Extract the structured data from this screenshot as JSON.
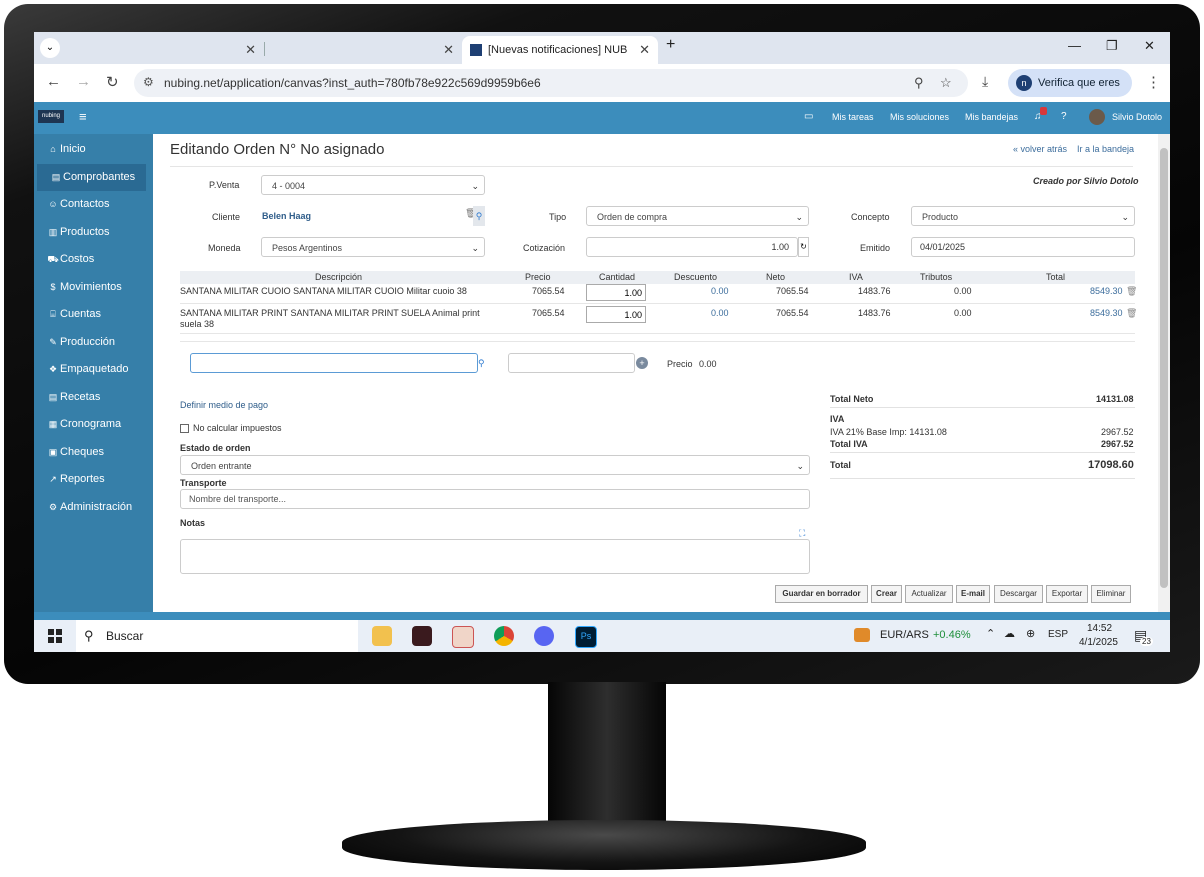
{
  "browser": {
    "tabs": [
      {
        "title": "",
        "active": false
      },
      {
        "title": "",
        "active": false
      },
      {
        "title": "[Nuevas notificaciones] NUBING",
        "active": true
      }
    ],
    "url": "nubing.net/application/canvas?inst_auth=780fb78e922c569d9959b6e6",
    "verify_label": "Verifica que eres tú"
  },
  "header": {
    "logo": "nubing",
    "links": [
      "Mis tareas",
      "Mis soluciones",
      "Mis bandejas"
    ],
    "user": "Silvio Dotolo"
  },
  "sidebar": {
    "items": [
      {
        "label": "Inicio",
        "icon": "home-icon",
        "glyph": "⌂"
      },
      {
        "label": "Comprobantes",
        "icon": "list-icon",
        "glyph": "▤"
      },
      {
        "label": "Contactos",
        "icon": "users-icon",
        "glyph": "☺"
      },
      {
        "label": "Productos",
        "icon": "box-icon",
        "glyph": "▥"
      },
      {
        "label": "Costos",
        "icon": "cart-icon",
        "glyph": "⛟"
      },
      {
        "label": "Movimientos",
        "icon": "dollar-icon",
        "glyph": "$"
      },
      {
        "label": "Cuentas",
        "icon": "bank-icon",
        "glyph": "⌸"
      },
      {
        "label": "Producción",
        "icon": "wrench-icon",
        "glyph": "✎"
      },
      {
        "label": "Empaquetado",
        "icon": "cubes-icon",
        "glyph": "❖"
      },
      {
        "label": "Recetas",
        "icon": "list-alt-icon",
        "glyph": "▤"
      },
      {
        "label": "Cronograma",
        "icon": "calendar-icon",
        "glyph": "▦"
      },
      {
        "label": "Cheques",
        "icon": "money-icon",
        "glyph": "▣"
      },
      {
        "label": "Reportes",
        "icon": "chart-icon",
        "glyph": "↗"
      },
      {
        "label": "Administración",
        "icon": "cogs-icon",
        "glyph": "⚙"
      }
    ],
    "active_index": 1
  },
  "page": {
    "title": "Editando Orden N° No asignado",
    "back_link": "« volver atrás",
    "tray_link": "Ir a la bandeja",
    "created_by": "Creado por Silvio Dotolo"
  },
  "form": {
    "pventa_label": "P.Venta",
    "pventa_value": "4 - 0004",
    "cliente_label": "Cliente",
    "cliente_value": "Belen Haag",
    "tipo_label": "Tipo",
    "tipo_value": "Orden de compra",
    "concepto_label": "Concepto",
    "concepto_value": "Producto",
    "moneda_label": "Moneda",
    "moneda_value": "Pesos Argentinos",
    "cotizacion_label": "Cotización",
    "cotizacion_value": "1.00",
    "emitido_label": "Emitido",
    "emitido_value": "04/01/2025"
  },
  "items_table": {
    "headers": [
      "Descripción",
      "Precio",
      "Cantidad",
      "Descuento",
      "Neto",
      "IVA",
      "Tributos",
      "Total"
    ],
    "rows": [
      {
        "desc": "SANTANA MILITAR CUOIO SANTANA MILITAR CUOIO Militar cuoio 38",
        "precio": "7065.54",
        "cantidad": "1.00",
        "descuento": "0.00",
        "neto": "7065.54",
        "iva": "1483.76",
        "tributos": "0.00",
        "total": "8549.30"
      },
      {
        "desc": "SANTANA MILITAR PRINT SANTANA MILITAR PRINT SUELA Animal print suela 38",
        "precio": "7065.54",
        "cantidad": "1.00",
        "descuento": "0.00",
        "neto": "7065.54",
        "iva": "1483.76",
        "tributos": "0.00",
        "total": "8549.30"
      }
    ]
  },
  "add_row": {
    "precio_label": "Precio",
    "precio_value": "0.00"
  },
  "lower": {
    "payment_link": "Definir medio de pago",
    "no_tax_label": "No calcular impuestos",
    "estado_label": "Estado de orden",
    "estado_value": "Orden entrante",
    "transporte_label": "Transporte",
    "transporte_placeholder": "Nombre del transporte...",
    "notas_label": "Notas"
  },
  "totals": {
    "total_neto_label": "Total Neto",
    "total_neto_value": "14131.08",
    "iva_label": "IVA",
    "iva_line_label": "IVA 21% Base Imp: 14131.08",
    "iva_line_value": "2967.52",
    "total_iva_label": "Total IVA",
    "total_iva_value": "2967.52",
    "total_label": "Total",
    "total_value": "17098.60"
  },
  "actions": [
    "Guardar en borrador",
    "Crear",
    "Actualizar",
    "E-mail",
    "Descargar",
    "Exportar",
    "Eliminar"
  ],
  "taskbar": {
    "search": "Buscar",
    "ticker": "EUR/ARS",
    "ticker_change": "+0.46%",
    "lang": "ESP",
    "time": "14:52",
    "date": "4/1/2025",
    "notif_count": "23"
  },
  "colors": {
    "header_blue": "#3c8dbc",
    "sidebar_blue": "#367fa9",
    "link_blue": "#3c6d9c",
    "ticker_green": "#1e8f3a"
  }
}
